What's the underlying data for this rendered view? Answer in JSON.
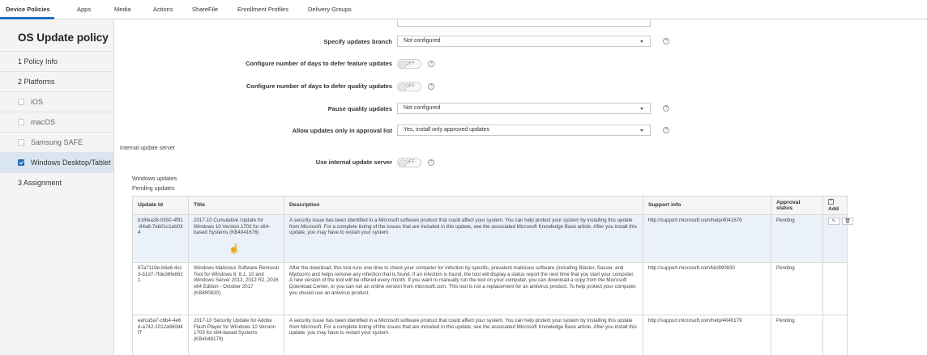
{
  "tabs": [
    "Device Policies",
    "Apps",
    "Media",
    "Actions",
    "ShareFile",
    "Enrollment Profiles",
    "Delivery Groups"
  ],
  "accent": "#1f6fbf",
  "sidebar": {
    "title": "OS Update policy",
    "items": [
      {
        "label": "1 Policy Info"
      },
      {
        "label": "2 Platforms"
      },
      {
        "label": "iOS"
      },
      {
        "label": "macOS"
      },
      {
        "label": "Samsung SAFE"
      },
      {
        "label": "Windows Desktop/Tablet"
      },
      {
        "label": "3 Assignment"
      }
    ]
  },
  "form": {
    "updates_branch_label": "Specify updates branch",
    "updates_branch_value": "Not configured",
    "defer_feature_label": "Configure number of days to defer feature updates",
    "defer_feature_value": "OFF",
    "defer_quality_label": "Configure number of days to defer quality updates",
    "defer_quality_value": "OFF",
    "pause_quality_label": "Pause quality updates",
    "pause_quality_value": "Not configured",
    "approval_list_label": "Allow updates only in approval list",
    "approval_list_value": "Yes, install only approved updates",
    "internal_server_section": "Internal update server",
    "use_internal_label": "Use internal update server",
    "use_internal_value": "OFF",
    "help_glyph": "?"
  },
  "windows_updates_label": "Windows updates",
  "pending_updates_label": "Pending updates",
  "table": {
    "columns": [
      "Update Id",
      "Title",
      "Description",
      "Support info",
      "Approval status",
      "Add"
    ],
    "rows": [
      {
        "id": "b16fea38-0350-4f91-84a8-7eb01c1eb034",
        "title": "2017-10 Cumulative Update for Windows 10 Version 1703 for x64-based Systems (KB4041676)",
        "description": "A security issue has been identified in a Microsoft software product that could affect your system. You can help protect your system by installing this update from Microsoft. For a complete listing of the issues that are included in this update, see the associated Microsoft Knowledge Base article. After you install this update, you may have to restart your system.",
        "support": "http://support.microsoft.com/help/4041676",
        "status": "Pending"
      },
      {
        "id": "87a7119e-b6a6-4cc3-b1d7-7fde36fe6621",
        "title": "Windows Malicious Software Removal Tool for Windows 8, 8.1, 10 and Windows Server 2012, 2012 R2, 2016 x64 Edition - October 2017 (KB890830)",
        "description": "After the download, this tool runs one time to check your computer for infection by specific, prevalent malicious software (including Blaster, Sasser, and Mydoom) and helps remove any infection that is found. If an infection is found, the tool will display a status report the next time that you start your computer. A new version of the tool will be offered every month. If you want to manually run the tool on your computer, you can download a copy from the Microsoft Download Center, or you can run an online version from microsoft.com. This tool is not a replacement for an antivirus product. To help protect your computer, you should use an antivirus product.",
        "support": "http://support.microsoft.com/kb/890830",
        "status": "Pending"
      },
      {
        "id": "eefca5a7-c6b4-4e6d-a742-1012a960d4f7",
        "title": "2017-10 Security Update for Adobe Flash Player for Windows 10 Version 1703 for x64-based Systems (KB4049179)",
        "description": "A security issue has been identified in a Microsoft software product that could affect your system. You can help protect your system by installing this update from Microsoft. For a complete listing of the issues that are included in this update, see the associated Microsoft Knowledge Base article. After you install this update, you may have to restart your system.",
        "support": "http://support.microsoft.com/help/4049179",
        "status": "Pending"
      }
    ]
  }
}
